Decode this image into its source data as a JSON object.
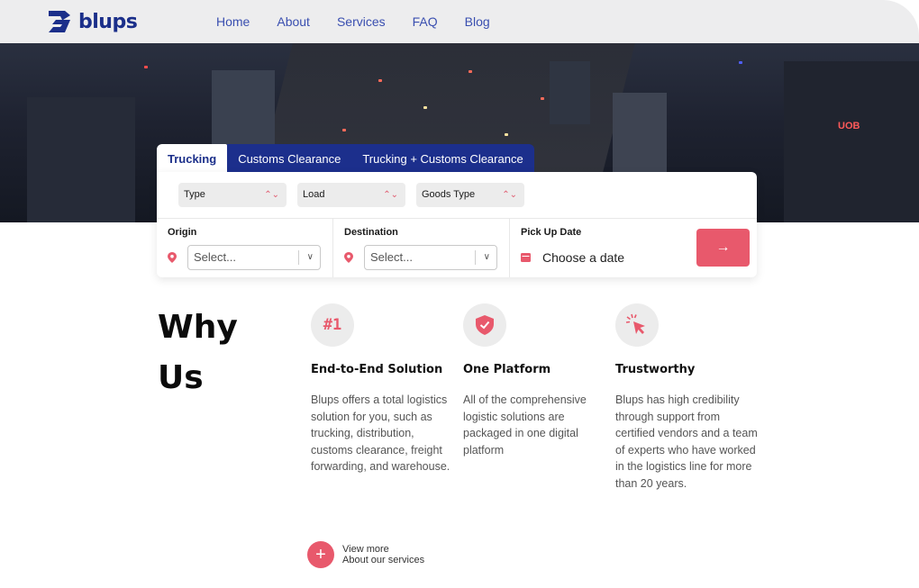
{
  "brand": {
    "name": "blups",
    "color": "#1b2f8a",
    "accent": "#e8596c"
  },
  "nav": [
    {
      "label": "Home"
    },
    {
      "label": "About"
    },
    {
      "label": "Services"
    },
    {
      "label": "FAQ"
    },
    {
      "label": "Blog"
    }
  ],
  "hero": {
    "sign_text": "UOB"
  },
  "search": {
    "tabs": [
      {
        "label": "Trucking",
        "active": true
      },
      {
        "label": "Customs Clearance",
        "active": false
      },
      {
        "label": "Trucking + Customs Clearance",
        "active": false
      }
    ],
    "filters": [
      {
        "label": "Type"
      },
      {
        "label": "Load"
      },
      {
        "label": "Goods Type"
      }
    ],
    "origin": {
      "label": "Origin",
      "placeholder": "Select..."
    },
    "destination": {
      "label": "Destination",
      "placeholder": "Select..."
    },
    "pickup": {
      "label": "Pick Up Date",
      "placeholder": "Choose a date"
    },
    "submit_icon": "arrow-right-icon"
  },
  "why": {
    "title_line1": "Why",
    "title_line2": "Us",
    "features": [
      {
        "icon": "number-one-icon",
        "icon_text": "#1",
        "title": "End-to-End Solution",
        "body": "Blups offers a total logistics solution for you, such as trucking, distribution, customs clearance, freight forwarding, and warehouse."
      },
      {
        "icon": "shield-check-icon",
        "title": "One Platform",
        "body": "All of the comprehensive logistic solutions are packaged in one digital platform"
      },
      {
        "icon": "cursor-click-icon",
        "title": "Trustworthy",
        "body": "Blups has high credibility through support from certified vendors and a team of experts who have worked in the logistics line for more than 20 years."
      }
    ],
    "more_line1": "View more",
    "more_line2": "About our services"
  }
}
